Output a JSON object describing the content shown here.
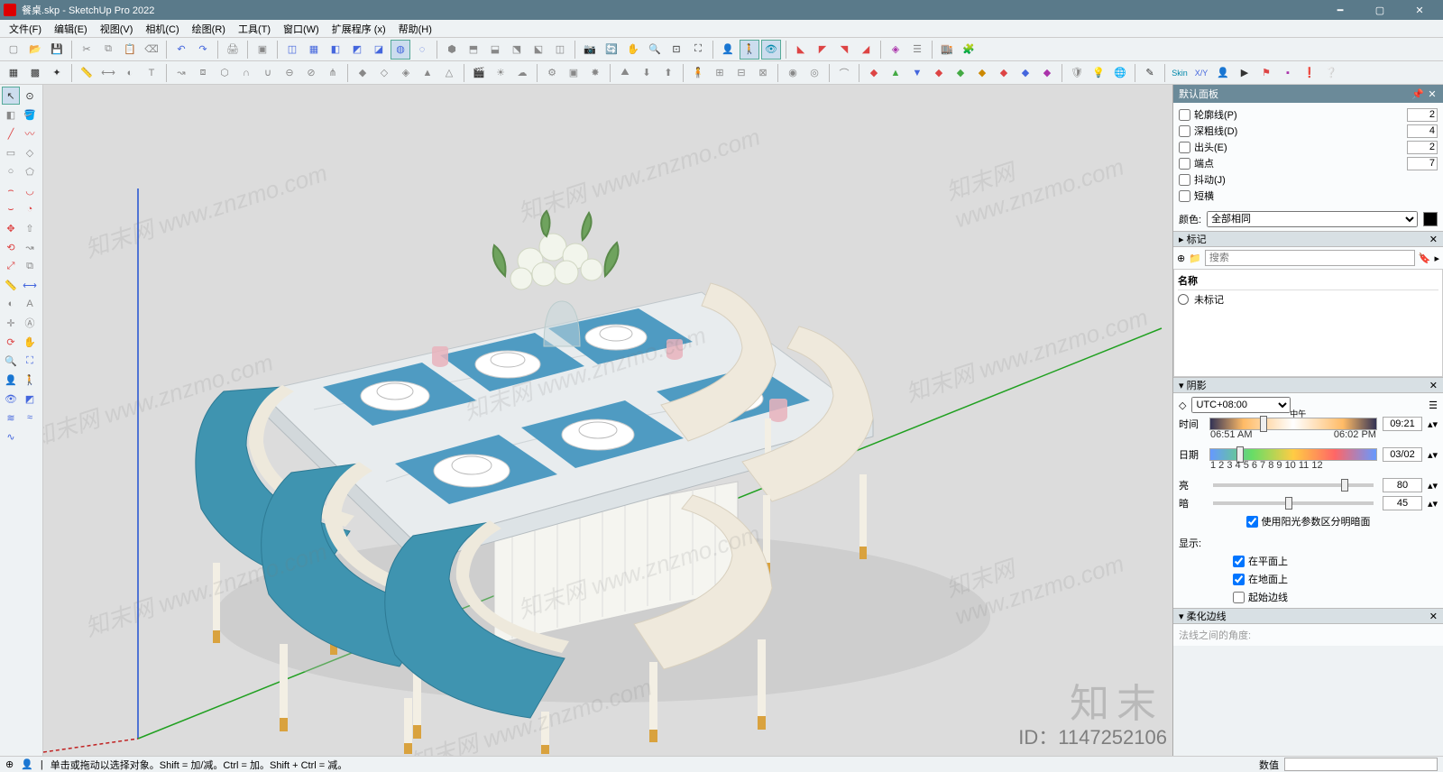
{
  "titlebar": {
    "app_icon": "sketchup-logo",
    "title": "餐桌.skp - SketchUp Pro 2022"
  },
  "menubar": [
    "文件(F)",
    "编辑(E)",
    "视图(V)",
    "相机(C)",
    "绘图(R)",
    "工具(T)",
    "窗口(W)",
    "扩展程序 (x)",
    "帮助(H)"
  ],
  "panels": {
    "default_panel_title": "默认面板",
    "styles": {
      "items": [
        {
          "label": "轮廓线(P)",
          "value": "2",
          "checked": false
        },
        {
          "label": "深粗线(D)",
          "value": "4",
          "checked": false
        },
        {
          "label": "出头(E)",
          "value": "2",
          "checked": false
        },
        {
          "label": "端点",
          "value": "7",
          "checked": false
        },
        {
          "label": "抖动(J)",
          "value": "",
          "checked": false
        },
        {
          "label": "短横",
          "value": "",
          "checked": false
        }
      ],
      "color_label": "颜色:",
      "color_mode": "全部相同"
    },
    "tags": {
      "title": "标记",
      "search_placeholder": "搜索",
      "column": "名称",
      "items": [
        "未标记"
      ]
    },
    "shadows": {
      "title": "阴影",
      "tz": "UTC+08:00",
      "time_label": "时间",
      "time_start": "06:51 AM",
      "time_end": "06:02 PM",
      "time_value": "09:21",
      "date_label": "日期",
      "date_ticks": "1 2 3 4 5 6 7 8 9 10 11 12",
      "date_value": "03/02",
      "light_label": "亮",
      "light_value": "80",
      "dark_label": "暗",
      "dark_value": "45",
      "use_sun": "使用阳光参数区分明暗面",
      "display_label": "显示:",
      "on_faces": "在平面上",
      "on_ground": "在地面上",
      "from_edges": "起始边线"
    },
    "soften": {
      "title": "柔化边线",
      "angle_label": "法线之间的角度:"
    }
  },
  "statusbar": {
    "hint": "单击或拖动以选择对象。Shift = 加/减。Ctrl = 加。Shift + Ctrl = 减。",
    "measure_label": "数值"
  },
  "watermark": {
    "text": "知末网 www.znzmo.com",
    "big": "知末",
    "id": "ID：1147252106"
  }
}
